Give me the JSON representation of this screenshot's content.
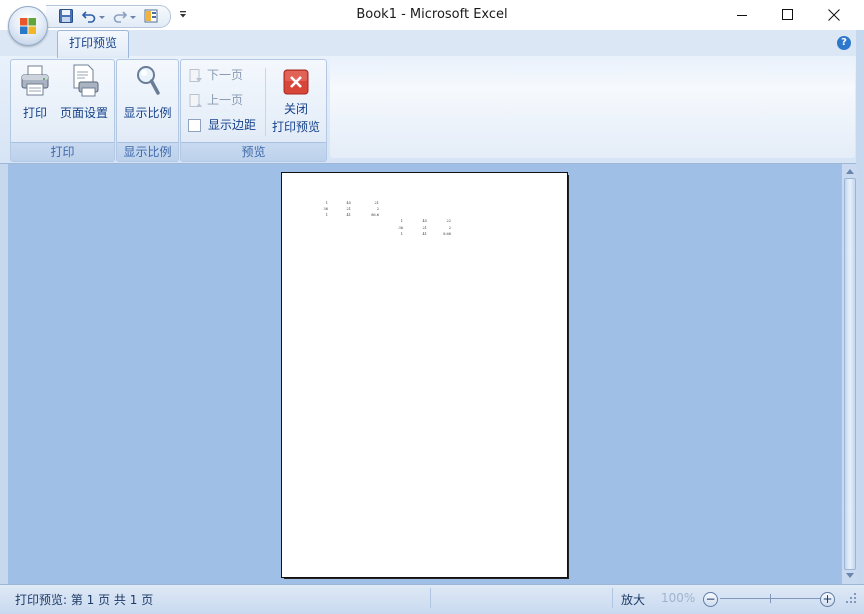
{
  "window": {
    "title": "Book1 - Microsoft Excel"
  },
  "icons": {
    "office": "office-button-icon",
    "save": "save-icon",
    "undo": "undo-icon",
    "redo": "redo-icon",
    "quick_print": "quick-print-icon",
    "customize": "customize-qat-icon",
    "minimize": "minimize-icon",
    "maximize": "maximize-icon",
    "close": "close-icon",
    "help": "help-icon"
  },
  "ribbon": {
    "tab_label": "打印预览",
    "help_glyph": "?",
    "groups": {
      "print": {
        "label": "打印",
        "print_button": "打印",
        "page_setup_button": "页面设置"
      },
      "zoom": {
        "label": "显示比例",
        "zoom_button": "显示比例"
      },
      "preview": {
        "label": "预览",
        "next_page": "下一页",
        "prev_page": "上一页",
        "show_margins": "显示边距",
        "close_line1": "关闭",
        "close_line2": "打印预览"
      }
    }
  },
  "preview_page": {
    "table1": [
      [
        "1",
        "45",
        "21"
      ],
      [
        "36",
        "21",
        "2"
      ],
      [
        "1",
        "41",
        "86.6"
      ]
    ],
    "table2": [
      [
        "1",
        "45",
        "22"
      ],
      [
        "36",
        "21",
        "2"
      ],
      [
        "1",
        "41",
        "8.66"
      ]
    ]
  },
  "statusbar": {
    "page_info": "打印预览: 第 1 页  共 1 页",
    "zoom_label": "放大",
    "zoom_value": "100%",
    "zoom_minus": "−",
    "zoom_plus": "+"
  },
  "colors": {
    "workspace": "#9fbfe6",
    "ribbon_text": "#15428b",
    "close_button_red": "#d8463a"
  }
}
